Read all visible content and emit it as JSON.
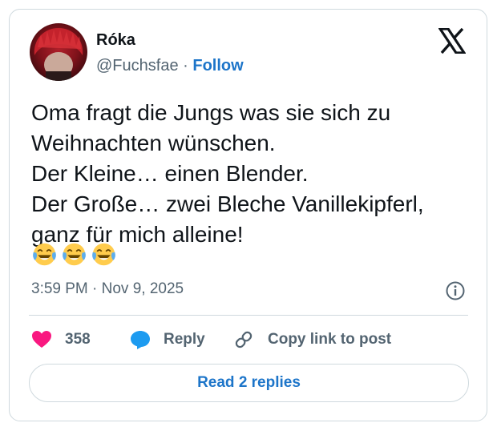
{
  "author": {
    "name": "Róka",
    "handle": "@Fuchsfae",
    "separator": "·",
    "follow_label": "Follow"
  },
  "tweet": {
    "lines": [
      "Oma fragt die Jungs was sie sich zu",
      "Weihnachten wünschen.",
      "Der Kleine… einen Blender.",
      "Der Große… zwei Bleche Vanillekipferl,",
      "ganz für mich alleine!"
    ],
    "emojis": [
      "face-with-tears-of-joy-icon",
      "face-with-tears-of-joy-icon",
      "face-with-tears-of-joy-icon"
    ],
    "timestamp": "3:59 PM · Nov 9, 2025"
  },
  "actions": {
    "like_count": "358",
    "reply_label": "Reply",
    "copy_label": "Copy link to post"
  },
  "read_replies_label": "Read 2 replies",
  "colors": {
    "text": "#0f1419",
    "secondary": "#536471",
    "link": "#1d75c9",
    "like": "#f91880",
    "reply_bubble": "#1d9bf0",
    "border": "#cfd9de"
  }
}
